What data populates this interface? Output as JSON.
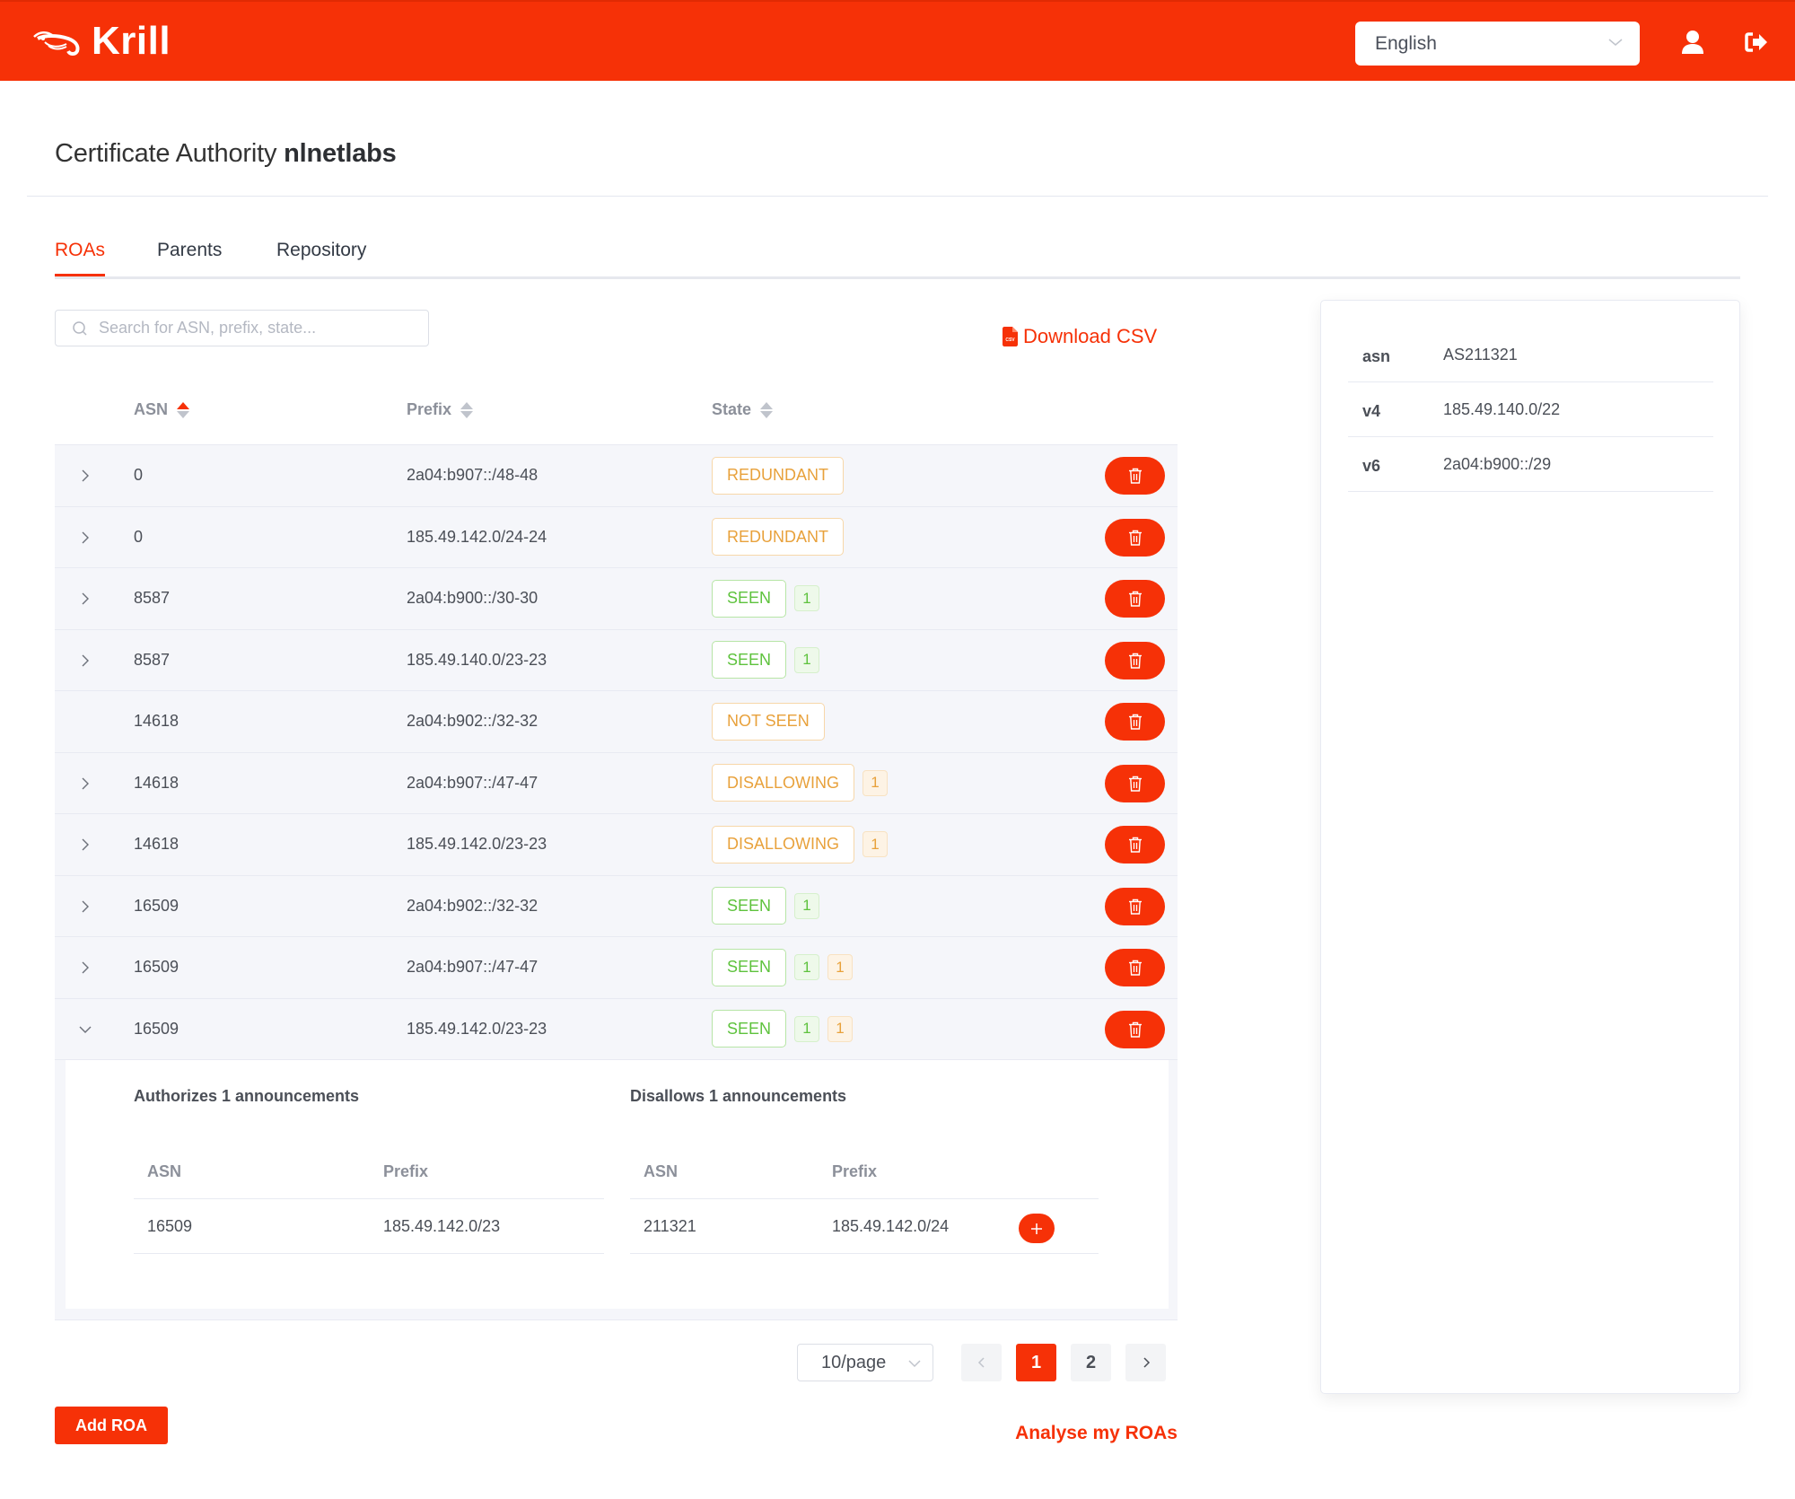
{
  "header": {
    "app_name": "Krill",
    "language": "English",
    "brand_color": "#f63107"
  },
  "page": {
    "title_prefix": "Certificate Authority",
    "ca_name": "nlnetlabs"
  },
  "tabs": [
    {
      "label": "ROAs",
      "active": true
    },
    {
      "label": "Parents",
      "active": false
    },
    {
      "label": "Repository",
      "active": false
    }
  ],
  "search": {
    "placeholder": "Search for ASN, prefix, state...",
    "value": ""
  },
  "download_csv_label": "Download CSV",
  "table": {
    "columns": [
      {
        "label": "ASN",
        "sort": "ascending"
      },
      {
        "label": "Prefix",
        "sort": "none"
      },
      {
        "label": "State",
        "sort": "none"
      }
    ],
    "rows": [
      {
        "asn": "0",
        "prefix": "2a04:b907::/48-48",
        "state": "REDUNDANT",
        "state_color": "orange",
        "counts": [],
        "expandable": true,
        "expanded": false
      },
      {
        "asn": "0",
        "prefix": "185.49.142.0/24-24",
        "state": "REDUNDANT",
        "state_color": "orange",
        "counts": [],
        "expandable": true,
        "expanded": false
      },
      {
        "asn": "8587",
        "prefix": "2a04:b900::/30-30",
        "state": "SEEN",
        "state_color": "green",
        "counts": [
          {
            "value": "1",
            "color": "green"
          }
        ],
        "expandable": true,
        "expanded": false
      },
      {
        "asn": "8587",
        "prefix": "185.49.140.0/23-23",
        "state": "SEEN",
        "state_color": "green",
        "counts": [
          {
            "value": "1",
            "color": "green"
          }
        ],
        "expandable": true,
        "expanded": false
      },
      {
        "asn": "14618",
        "prefix": "2a04:b902::/32-32",
        "state": "NOT SEEN",
        "state_color": "orange",
        "counts": [],
        "expandable": false,
        "expanded": false
      },
      {
        "asn": "14618",
        "prefix": "2a04:b907::/47-47",
        "state": "DISALLOWING",
        "state_color": "orange",
        "counts": [
          {
            "value": "1",
            "color": "orange"
          }
        ],
        "expandable": true,
        "expanded": false
      },
      {
        "asn": "14618",
        "prefix": "185.49.142.0/23-23",
        "state": "DISALLOWING",
        "state_color": "orange",
        "counts": [
          {
            "value": "1",
            "color": "orange"
          }
        ],
        "expandable": true,
        "expanded": false
      },
      {
        "asn": "16509",
        "prefix": "2a04:b902::/32-32",
        "state": "SEEN",
        "state_color": "green",
        "counts": [
          {
            "value": "1",
            "color": "green"
          }
        ],
        "expandable": true,
        "expanded": false
      },
      {
        "asn": "16509",
        "prefix": "2a04:b907::/47-47",
        "state": "SEEN",
        "state_color": "green",
        "counts": [
          {
            "value": "1",
            "color": "green"
          },
          {
            "value": "1",
            "color": "orange"
          }
        ],
        "expandable": true,
        "expanded": false
      },
      {
        "asn": "16509",
        "prefix": "185.49.142.0/23-23",
        "state": "SEEN",
        "state_color": "green",
        "counts": [
          {
            "value": "1",
            "color": "green"
          },
          {
            "value": "1",
            "color": "orange"
          }
        ],
        "expandable": true,
        "expanded": true
      }
    ],
    "expanded_detail": {
      "authorizes": {
        "title": "Authorizes 1 announcements",
        "columns": [
          "ASN",
          "Prefix"
        ],
        "rows": [
          {
            "asn": "16509",
            "prefix": "185.49.142.0/23"
          }
        ]
      },
      "disallows": {
        "title": "Disallows 1 announcements",
        "columns": [
          "ASN",
          "Prefix"
        ],
        "rows": [
          {
            "asn": "211321",
            "prefix": "185.49.142.0/24"
          }
        ]
      }
    }
  },
  "pagination": {
    "page_size": "10/page",
    "pages": [
      "1",
      "2"
    ],
    "current": "1"
  },
  "add_roa_label": "Add ROA",
  "analyse_label": "Analyse my ROAs",
  "info": [
    {
      "key": "asn",
      "value": "AS211321"
    },
    {
      "key": "v4",
      "value": "185.49.140.0/22"
    },
    {
      "key": "v6",
      "value": "2a04:b900::/29"
    }
  ]
}
